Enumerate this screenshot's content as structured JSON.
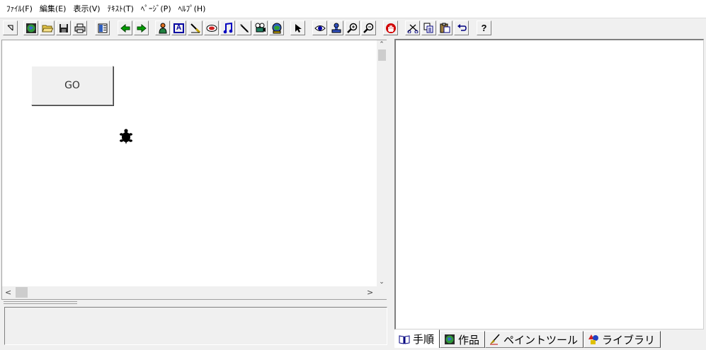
{
  "menu": [
    "ﾌｧｲﾙ(F)",
    "編集(E)",
    "表示(V)",
    "ﾃｷｽﾄ(T)",
    "ﾍﾟｰｼﾞ(P)",
    "ﾍﾙﾌﾟ(H)"
  ],
  "toolbar": {
    "buttons": [
      "pointer-arrow-icon",
      "globe-icon",
      "open-folder-icon",
      "save-disk-icon",
      "print-icon",
      "page-layout-icon",
      "back-arrow-icon",
      "forward-arrow-icon",
      "character-icon",
      "text-box-icon",
      "paint-icon",
      "button-icon",
      "music-note-icon",
      "pen-tool-icon",
      "video-camera-icon",
      "stamp-globe-icon",
      "select-cursor-icon",
      "view-eye-icon",
      "stamp-icon",
      "zoom-in-icon",
      "zoom-out-icon",
      "stop-hand-icon",
      "cut-scissors-icon",
      "copy-icon",
      "paste-icon",
      "undo-icon",
      "help-question-icon"
    ],
    "help_label": "?",
    "text_icon_label": "A"
  },
  "canvas": {
    "go_button_label": "GO"
  },
  "tabs": [
    {
      "label": "手順",
      "icon": "book-icon",
      "active": true
    },
    {
      "label": "作品",
      "icon": "globe-icon",
      "active": false
    },
    {
      "label": "ペイントツール",
      "icon": "paint-brush-icon",
      "active": false
    },
    {
      "label": "ライブラリ",
      "icon": "shapes-icon",
      "active": false
    }
  ],
  "colors": {
    "window_bg": "#f0f0f0",
    "canvas_bg": "#ffffff",
    "arrow_green": "#00a000",
    "icon_blue": "#0000c0",
    "stop_red": "#d00000"
  }
}
